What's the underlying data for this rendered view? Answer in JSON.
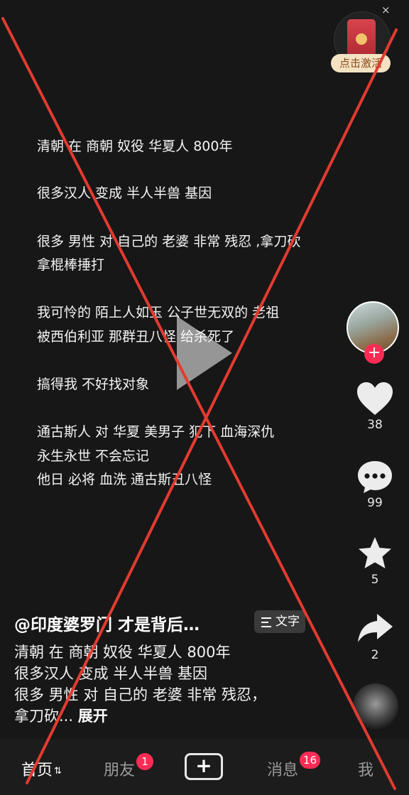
{
  "top_widget": {
    "close_label": "×",
    "badge_label": "点击激活",
    "icon": "red-envelope-icon"
  },
  "video_overlay_text": [
    "清朝 在 商朝 奴役 华夏人 800年",
    "很多汉人 变成 半人半兽 基因",
    "很多 男性 对 自己的 老婆 非常 残忍 ,拿刀砍",
    "拿棍棒捶打",
    "我可怜的 陌上人如玉 公子世无双的 老祖",
    "被西伯利亚 那群丑八怪 给杀死了",
    "搞得我 不好找对象",
    "通古斯人 对 华夏 美男子 犯下 血海深仇",
    "永生永世 不会忘记",
    "他日 必将 血洗 通古斯丑八怪"
  ],
  "right_rail": {
    "follow_label": "+",
    "likes": "38",
    "comments": "99",
    "favorites": "5",
    "shares": "2"
  },
  "post": {
    "author": "@印度婆罗门 才是背后…",
    "text_button_label": "文字",
    "caption_lines": [
      "清朝 在 商朝 奴役 华夏人 800年",
      "很多汉人 变成 半人半兽 基因",
      "很多 男性 对 自己的 老婆 非常 残忍，"
    ],
    "caption_last": "拿刀砍...",
    "expand_label": "展开"
  },
  "tabbar": {
    "home": "首页",
    "home_arrows": "⇅",
    "friends": "朋友",
    "friends_badge": "1",
    "create_label": "+",
    "messages": "消息",
    "messages_badge": "16",
    "me": "我"
  },
  "colors": {
    "background": "#161616",
    "accent": "#fe2c55",
    "cross_stroke": "#e33b30"
  }
}
